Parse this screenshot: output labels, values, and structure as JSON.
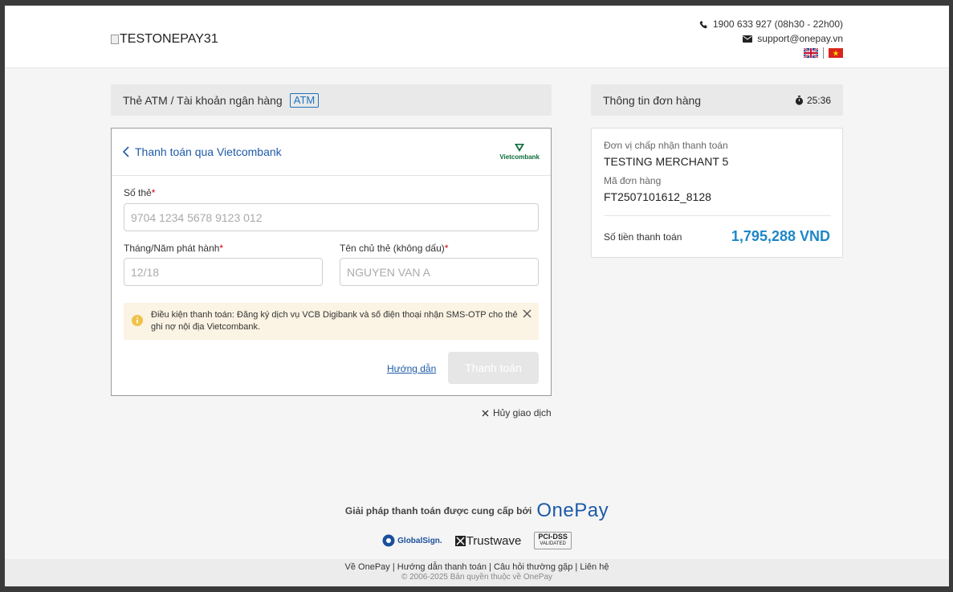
{
  "header": {
    "logo_alt": "TESTONEPAY31",
    "phone": "1900 633 927 (08h30 - 22h00)",
    "email": "support@onepay.vn"
  },
  "payment": {
    "method_title": "Thẻ ATM / Tài khoản ngân hàng",
    "method_badge": "ATM",
    "back_label": "Thanh toán qua Vietcombank",
    "bank_logo_text": "Vietcombank",
    "card_number_label": "Số thẻ",
    "card_number_placeholder": "9704 1234 5678 9123 012",
    "issue_date_label": "Tháng/Năm phát hành",
    "issue_date_placeholder": "12/18",
    "holder_label": "Tên chủ thẻ (không dấu)",
    "holder_placeholder": "NGUYEN VAN A",
    "required_mark": "*",
    "notice": "Điều kiện thanh toán: Đăng ký dịch vụ VCB Digibank và số điện thoại nhận SMS-OTP cho thẻ ghi nợ nội địa Vietcombank.",
    "guide_link": "Hướng dẫn",
    "pay_button": "Thanh toán",
    "cancel": "Hủy giao dịch"
  },
  "order": {
    "title": "Thông tin đơn hàng",
    "timer": "25:36",
    "merchant_label": "Đơn vị chấp nhận thanh toán",
    "merchant_value": "TESTING MERCHANT 5",
    "order_id_label": "Mã đơn hàng",
    "order_id_value": "FT2507101612_8128",
    "amount_label": "Số tiền thanh toán",
    "amount_value": "1,795,288 VND"
  },
  "footer": {
    "powered_by": "Giải pháp thanh toán được cung cấp bởi",
    "brand": "OnePay",
    "badges": [
      "GlobalSign.",
      "Trustwave",
      "PCI-DSS"
    ],
    "badge_sub": "VALIDATED",
    "links": [
      "Về OnePay",
      "Hướng dẫn thanh toán",
      "Câu hỏi thường gặp",
      "Liên hệ"
    ],
    "copyright": "© 2006-2025 Bản quyền thuộc về OnePay"
  },
  "colors": {
    "accent_blue": "#1e5aa8",
    "amount_blue": "#1e87c8",
    "notice_bg": "#fbf3e3",
    "vcb_green": "#0b6b3a"
  }
}
